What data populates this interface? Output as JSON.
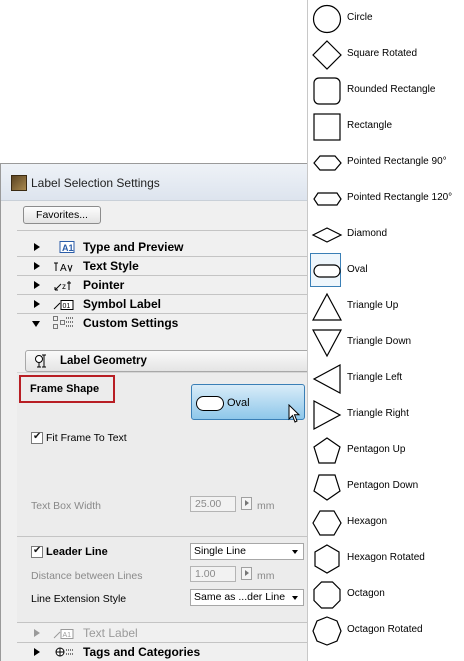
{
  "dialog": {
    "title": "Label Selection Settings",
    "favorites_label": "Favorites...",
    "panels": [
      {
        "label": "Type and Preview",
        "icon": "type-preview-icon",
        "state": "collapsed",
        "enabled": true
      },
      {
        "label": "Text Style",
        "icon": "text-style-icon",
        "state": "collapsed",
        "enabled": true
      },
      {
        "label": "Pointer",
        "icon": "pointer-icon",
        "state": "collapsed",
        "enabled": true
      },
      {
        "label": "Symbol Label",
        "icon": "symbol-label-icon",
        "state": "collapsed",
        "enabled": true
      },
      {
        "label": "Custom Settings",
        "icon": "custom-settings-icon",
        "state": "expanded",
        "enabled": true
      }
    ],
    "geometry_section_label": "Label Geometry",
    "frame_shape_label": "Frame Shape",
    "frame_shape_value": "Oval",
    "fit_frame_label": "Fit Frame To Text",
    "fit_frame_checked": true,
    "text_box_width_label": "Text Box Width",
    "text_box_width_value": "25.00",
    "text_box_width_unit": "mm",
    "leader_line_label": "Leader Line",
    "leader_line_checked": true,
    "leader_line_type": "Single Line",
    "distance_label": "Distance between Lines",
    "distance_value": "1.00",
    "distance_unit": "mm",
    "extension_style_label": "Line Extension Style",
    "extension_style_value": "Same as ...der Line",
    "bottom_panels": [
      {
        "label": "Text Label",
        "icon": "text-label-icon",
        "state": "collapsed",
        "enabled": false
      },
      {
        "label": "Tags and Categories",
        "icon": "tags-categories-icon",
        "state": "collapsed",
        "enabled": true
      }
    ]
  },
  "popup": {
    "selected": "Oval",
    "items": [
      {
        "name": "Circle",
        "icon": "circle-icon"
      },
      {
        "name": "Square Rotated",
        "icon": "square-rotated-icon"
      },
      {
        "name": "Rounded Rectangle",
        "icon": "rounded-rectangle-icon"
      },
      {
        "name": "Rectangle",
        "icon": "rectangle-icon"
      },
      {
        "name": "Pointed Rectangle 90°",
        "icon": "pointed-rectangle-90-icon"
      },
      {
        "name": "Pointed Rectangle 120°",
        "icon": "pointed-rectangle-120-icon"
      },
      {
        "name": "Diamond",
        "icon": "diamond-icon"
      },
      {
        "name": "Oval",
        "icon": "oval-icon"
      },
      {
        "name": "Triangle Up",
        "icon": "triangle-up-icon"
      },
      {
        "name": "Triangle Down",
        "icon": "triangle-down-icon"
      },
      {
        "name": "Triangle Left",
        "icon": "triangle-left-icon"
      },
      {
        "name": "Triangle Right",
        "icon": "triangle-right-icon"
      },
      {
        "name": "Pentagon Up",
        "icon": "pentagon-up-icon"
      },
      {
        "name": "Pentagon Down",
        "icon": "pentagon-down-icon"
      },
      {
        "name": "Hexagon",
        "icon": "hexagon-icon"
      },
      {
        "name": "Hexagon Rotated",
        "icon": "hexagon-rotated-icon"
      },
      {
        "name": "Octagon",
        "icon": "octagon-icon"
      },
      {
        "name": "Octagon Rotated",
        "icon": "octagon-rotated-icon"
      }
    ]
  },
  "colors": {
    "highlight_border": "#b81e24",
    "selected_button": "#8ec7ea",
    "selection_outline": "#3a7fb6"
  }
}
